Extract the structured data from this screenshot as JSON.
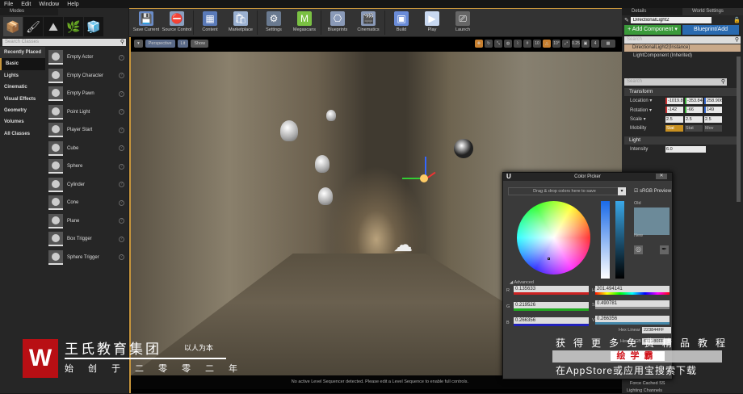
{
  "menu": [
    "File",
    "Edit",
    "Window",
    "Help"
  ],
  "modes": {
    "tab": "Modes",
    "search_placeholder": "Search Classes",
    "categories": [
      "Recently Placed",
      "Basic",
      "Lights",
      "Cinematic",
      "Visual Effects",
      "Geometry",
      "Volumes",
      "All Classes"
    ],
    "selected_category": "Basic",
    "items": [
      "Empty Actor",
      "Empty Character",
      "Empty Pawn",
      "Point Light",
      "Player Start",
      "Cube",
      "Sphere",
      "Cylinder",
      "Cone",
      "Plane",
      "Box Trigger",
      "Sphere Trigger"
    ]
  },
  "toolbar": [
    {
      "label": "Save Current",
      "icon": "save-icon",
      "color": "#6a8cc8"
    },
    {
      "label": "Source Control",
      "icon": "source-control-icon",
      "color": "#8aa0c0"
    },
    {
      "label": "Content",
      "icon": "content-icon",
      "color": "#5a7ab8"
    },
    {
      "label": "Marketplace",
      "icon": "marketplace-icon",
      "color": "#9ab0d0"
    },
    {
      "label": "Settings",
      "icon": "settings-icon",
      "color": "#6a7a90"
    },
    {
      "label": "Megascans",
      "icon": "megascans-icon",
      "color": "#7ac143"
    },
    {
      "label": "Blueprints",
      "icon": "blueprints-icon",
      "color": "#8a9ab8"
    },
    {
      "label": "Cinematics",
      "icon": "cinematics-icon",
      "color": "#8a9ab8"
    },
    {
      "label": "Build",
      "icon": "build-icon",
      "color": "#6a8cd8"
    },
    {
      "label": "Play",
      "icon": "play-icon",
      "color": "#c8d8f0"
    },
    {
      "label": "Launch",
      "icon": "launch-icon",
      "color": "#666666"
    }
  ],
  "viewport": {
    "options": "▾",
    "perspective": "Perspective",
    "lit": "Lit",
    "show": "Show",
    "snap_grid": "10",
    "snap_rot": "10°",
    "snap_scale": "0.25",
    "cam_speed": "4",
    "status": "No active Level Sequencer detected. Please edit a Level Sequence to enable full controls."
  },
  "details": {
    "tabs": [
      "Details",
      "World Settings"
    ],
    "name": "DirectionalLight2",
    "add_component": "+ Add Component ▾",
    "blueprint": "Blueprint/Add",
    "search_placeholder": "Search",
    "components": [
      "DirectionalLight2(Instance)",
      "LightComponent (Inherited)"
    ],
    "transform": {
      "title": "Transform",
      "location_label": "Location ▾",
      "location": [
        "-1019.8",
        "-353.84",
        "258.906"
      ],
      "rotation_label": "Rotation ▾",
      "rotation": [
        "-142",
        "-66",
        "149"
      ],
      "scale_label": "Scale ▾",
      "scale": [
        "2.5",
        "2.5",
        "2.5"
      ],
      "mobility_label": "Mobility",
      "mobility": [
        "Stat",
        "Stat",
        "Mov"
      ]
    },
    "light": {
      "title": "Light",
      "intensity_label": "Intensity",
      "intensity": "6.0"
    },
    "force_cached": "Force Cached SS",
    "lighting_channels": "Lighting Channels"
  },
  "picker": {
    "title": "Color Picker",
    "drop": "Drag & drop colors here to save",
    "srgb": "sRGB Preview",
    "old": "Old",
    "new": "New",
    "advanced": "Advanced",
    "r_label": "R",
    "r": "0.135633",
    "g_label": "G",
    "g": "0.219526",
    "b_label": "B",
    "b": "0.266356",
    "h_label": "H",
    "h": "201.494141",
    "s_label": "S",
    "s": "0.490781",
    "v_label": "V",
    "v": "0.266356",
    "hex_linear_label": "Hex Linear",
    "hex_linear": "223844FF",
    "hex_srgb_label": "Hex sRGB",
    "hex_srgb": "678180FF",
    "old_color": "#6c8a99"
  },
  "watermark": {
    "logo": "W",
    "name": "王氏教育集团",
    "slogan": "以人为本",
    "since": "始创于二零零二年",
    "promo1": "获得更多免费精品教程",
    "promo2": "绘学霸",
    "promo3": "在AppStore或应用宝搜索下载"
  }
}
